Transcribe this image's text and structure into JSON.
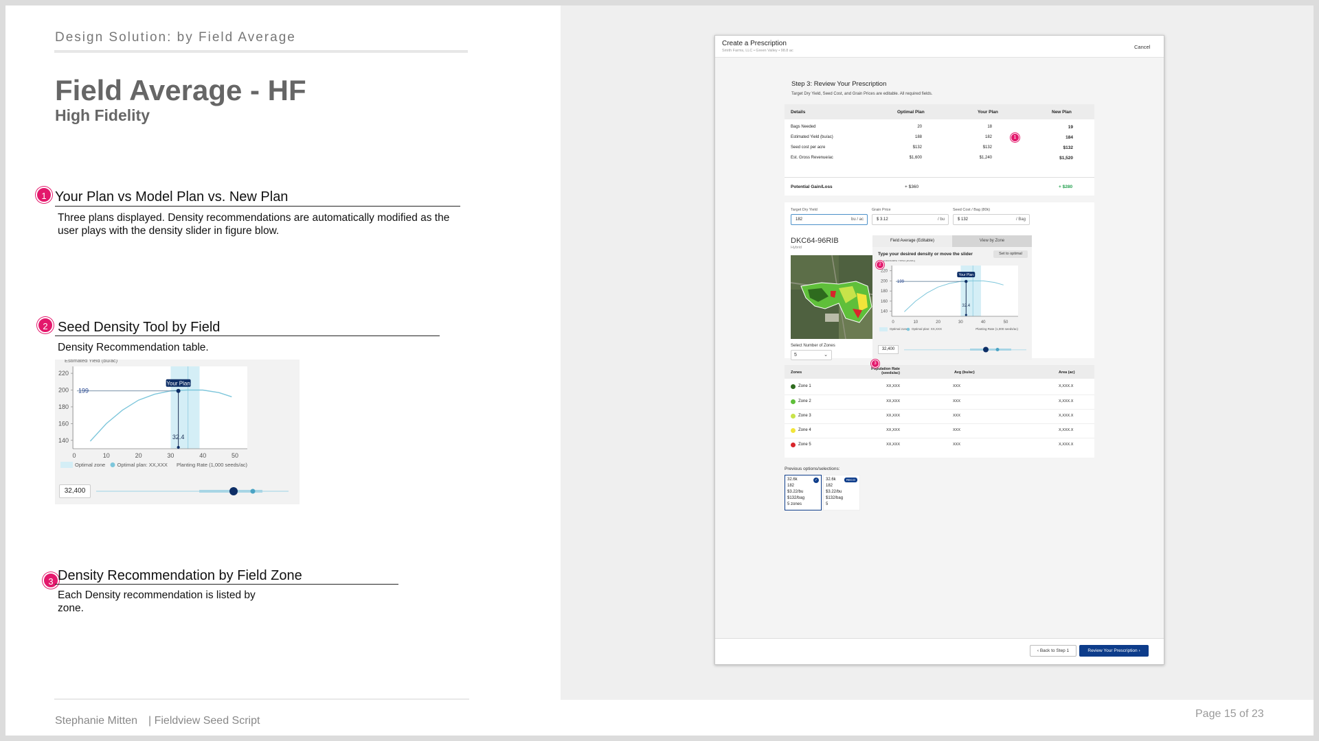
{
  "slide": {
    "kicker": "Design Solution: by Field Average",
    "title": "Field Average - HF",
    "subtitle": "High Fidelity",
    "sections": [
      {
        "num": "1",
        "title": "Your Plan vs Model Plan vs. New Plan",
        "desc": "Three plans displayed. Density recommendations are automatically modified as the user plays with the density slider in figure blow."
      },
      {
        "num": "2",
        "title": "Seed Density Tool by Field",
        "desc": "Density Recommendation table."
      },
      {
        "num": "3",
        "title": "Density Recommendation by Field Zone",
        "desc": "Each Density recommendation is listed by zone."
      }
    ],
    "footer_author": "Stephanie Mitten",
    "footer_project": "| Fieldview Seed Script",
    "page": "Page 15 of 23"
  },
  "chart_big": {
    "ylabel_partial": "Estimated Yield (bu/ac)",
    "marker_label": "Your Plan",
    "marker_x_label": "32.4",
    "ref_label": "199",
    "legend_zone": "Optimal zone",
    "legend_plan": "Optimal plan: XX,XXX",
    "xaxis_label": "Planting Rate (1,000 seeds/ac)",
    "slider_value": "32,400"
  },
  "chart_data": [
    {
      "type": "line",
      "ylabel": "Estimated Yield (bu/ac)",
      "xlabel": "Planting Rate (1,000 seeds/ac)",
      "x_ticks": [
        "0",
        "10",
        "20",
        "30",
        "40",
        "50"
      ],
      "y_ticks": [
        "140",
        "160",
        "180",
        "200",
        "220"
      ],
      "xlim": [
        0,
        50
      ],
      "ylim": [
        130,
        225
      ],
      "series": [
        {
          "x": [
            5,
            10,
            15,
            20,
            25,
            30,
            32.4,
            35,
            40,
            45,
            49
          ],
          "y": [
            139,
            160,
            176,
            188,
            195,
            199,
            199.5,
            200,
            200,
            197,
            192
          ]
        }
      ],
      "optimal_zone": [
        30,
        39
      ],
      "your_plan_x": 32.4,
      "reference_y": 199
    }
  ],
  "app": {
    "window_title": "Create a Prescription",
    "window_sub": "Smith Farms, LLC • Green Valley • 98.8 ac",
    "cancel": "Cancel",
    "step_title": "Step 3: Review Your Prescription",
    "step_sub": "Target Dry Yield, Seed Cost, and Grain Prices are editable. All required fields.",
    "table_headers": [
      "Details",
      "Optimal Plan",
      "Your Plan",
      "New Plan"
    ],
    "table_rows": [
      [
        "Bags Needed",
        "20",
        "18",
        "19"
      ],
      [
        "Estimated Yield (bu/ac)",
        "188",
        "182",
        "184"
      ],
      [
        "Seed cost per acre",
        "$132",
        "$132",
        "$132"
      ],
      [
        "Est. Gross Revenue/ac",
        "$1,600",
        "$1,240",
        "$1,520"
      ]
    ],
    "gain_row": [
      "Potential Gain/Loss",
      "+ $360",
      "",
      "+ $280"
    ],
    "inputs": [
      {
        "label": "Target Dry Yield",
        "value": "182",
        "unit": "bu / ac"
      },
      {
        "label": "Grain Price",
        "value": "$ 3.12",
        "unit": "/ bu"
      },
      {
        "label": "Seed Cost / Bag (80k)",
        "value": "$ 132",
        "unit": "/ Bag"
      }
    ],
    "hybrid_name": "DKC64-96RIB",
    "hybrid_type": "Hybrid",
    "zones_label": "Select Number of Zones",
    "zones_value": "5",
    "tab_active": "Field Average (Editable)",
    "tab_inactive": "View by Zone",
    "density_prompt": "Type your desired density or move the slider",
    "set_optimal": "Set to optimal",
    "zone_headers": [
      "Zones",
      "Population Rate (seeds/ac)",
      "Avg (bu/ac)",
      "Area (ac)"
    ],
    "zones": [
      {
        "name": "Zone 1",
        "rate": "XX,XXX",
        "avg": "XXX",
        "area": "X,XXX.X",
        "color": "#2e6b1e"
      },
      {
        "name": "Zone 2",
        "rate": "XX,XXX",
        "avg": "XXX",
        "area": "X,XXX.X",
        "color": "#5fbf3a"
      },
      {
        "name": "Zone 3",
        "rate": "XX,XXX",
        "avg": "XXX",
        "area": "X,XXX.X",
        "color": "#c8e34a"
      },
      {
        "name": "Zone 4",
        "rate": "XX,XXX",
        "avg": "XXX",
        "area": "X,XXX.X",
        "color": "#f2e53a"
      },
      {
        "name": "Zone 5",
        "rate": "XX,XXX",
        "avg": "XXX",
        "area": "X,XXX.X",
        "color": "#d8262b"
      }
    ],
    "prev_label": "Previous options/selections:",
    "prev_cards": [
      {
        "lines": [
          "32.6k",
          "182",
          "$3.22/bu",
          "$132/bag",
          "5 zones"
        ],
        "selected": true,
        "tag": ""
      },
      {
        "lines": [
          "32.6k",
          "182",
          "$3.22/bu",
          "$132/bag",
          "5"
        ],
        "selected": false,
        "tag": "RECO"
      }
    ],
    "back_btn": "Back to Step 1",
    "review_btn": "Review Your Prescription",
    "badge_1": "1",
    "badge_2": "2",
    "badge_3": "3"
  },
  "colors": {
    "accent": "#e3186c",
    "primary": "#0d3c8a",
    "curve": "#7dc6db",
    "zone": "#d4eef6",
    "gain": "#1e9e4a"
  }
}
